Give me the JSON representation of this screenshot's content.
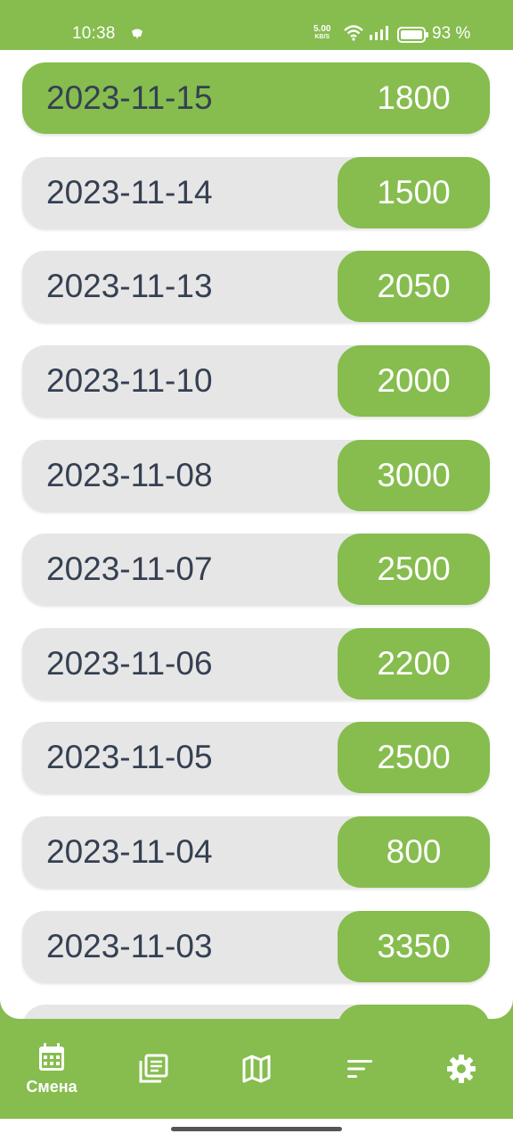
{
  "status_bar": {
    "time": "10:38",
    "net_speed": "5.00",
    "net_speed_unit": "KB/S",
    "battery_text": "93 %",
    "icons": [
      "notification-icon",
      "wifi-icon",
      "signal-icon",
      "battery-icon"
    ]
  },
  "shifts": [
    {
      "date": "2023-11-15",
      "amount": "1800"
    },
    {
      "date": "2023-11-14",
      "amount": "1500"
    },
    {
      "date": "2023-11-13",
      "amount": "2050"
    },
    {
      "date": "2023-11-10",
      "amount": "2000"
    },
    {
      "date": "2023-11-08",
      "amount": "3000"
    },
    {
      "date": "2023-11-07",
      "amount": "2500"
    },
    {
      "date": "2023-11-06",
      "amount": "2200"
    },
    {
      "date": "2023-11-05",
      "amount": "2500"
    },
    {
      "date": "2023-11-04",
      "amount": "800"
    },
    {
      "date": "2023-11-03",
      "amount": "3350"
    },
    {
      "date": "",
      "amount": ""
    }
  ],
  "bottom_nav": {
    "items": [
      {
        "icon": "calendar-icon",
        "label": "Смена",
        "active": true
      },
      {
        "icon": "notes-icon",
        "label": ""
      },
      {
        "icon": "map-icon",
        "label": ""
      },
      {
        "icon": "sort-icon",
        "label": ""
      },
      {
        "icon": "gear-icon",
        "label": ""
      }
    ]
  },
  "colors": {
    "accent": "#86bd4e",
    "row_bg": "#e6e6e6",
    "text_dark": "#354052"
  }
}
